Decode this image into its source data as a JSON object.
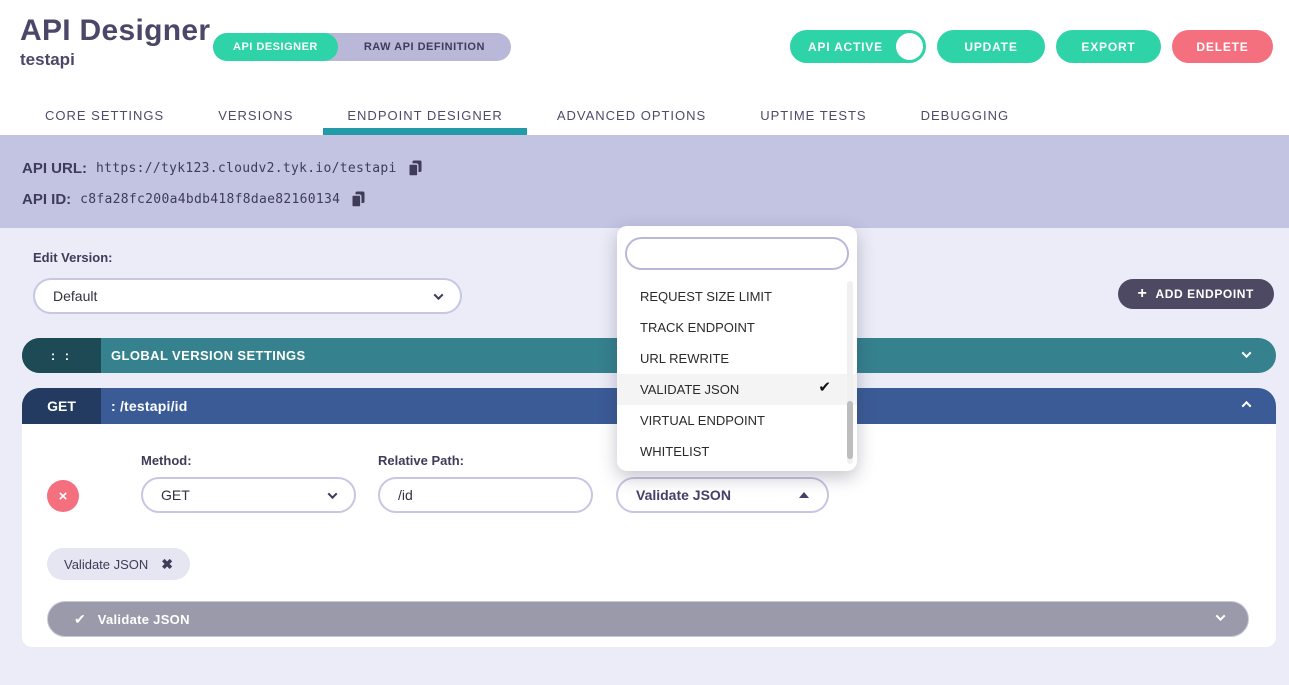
{
  "header": {
    "title": "API Designer",
    "subtitle": "testapi",
    "mode_toggle": {
      "api_designer": "API DESIGNER",
      "raw_api_definition": "RAW API DEFINITION"
    },
    "buttons": {
      "api_active": "API ACTIVE",
      "update": "UPDATE",
      "export": "EXPORT",
      "delete": "DELETE"
    }
  },
  "tabs": [
    {
      "label": "CORE SETTINGS",
      "active": false
    },
    {
      "label": "VERSIONS",
      "active": false
    },
    {
      "label": "ENDPOINT DESIGNER",
      "active": true
    },
    {
      "label": "ADVANCED OPTIONS",
      "active": false
    },
    {
      "label": "UPTIME TESTS",
      "active": false
    },
    {
      "label": "DEBUGGING",
      "active": false
    }
  ],
  "api_info": {
    "url_label": "API URL:",
    "url_value": "https://tyk123.cloudv2.tyk.io/testapi",
    "id_label": "API ID:",
    "id_value": "c8fa28fc200a4bdb418f8dae82160134"
  },
  "version_section": {
    "label": "Edit Version:",
    "selected_version": "Default",
    "add_endpoint_label": "ADD ENDPOINT"
  },
  "global_settings_bar": {
    "drag_handle": ": :",
    "title": "GLOBAL VERSION SETTINGS"
  },
  "endpoint_bar": {
    "method": "GET",
    "path": ": /testapi/id"
  },
  "endpoint_editor": {
    "method_label": "Method:",
    "method_value": "GET",
    "relative_path_label": "Relative Path:",
    "relative_path_value": "/id",
    "plugins_value": "Validate JSON",
    "selected_plugin_tag": "Validate JSON",
    "plugin_panel_title": "Validate JSON"
  },
  "plugin_dropdown": {
    "search_value": "",
    "options": [
      {
        "label": "REQUEST SIZE LIMIT",
        "selected": false
      },
      {
        "label": "TRACK ENDPOINT",
        "selected": false
      },
      {
        "label": "URL REWRITE",
        "selected": false
      },
      {
        "label": "VALIDATE JSON",
        "selected": true
      },
      {
        "label": "VIRTUAL ENDPOINT",
        "selected": false
      },
      {
        "label": "WHITELIST",
        "selected": false
      }
    ]
  },
  "icons": {
    "checkmark": "✔",
    "close_x": "✖",
    "remove_x": "×",
    "plus": "+"
  },
  "colors": {
    "teal_accent": "#2ed3a8",
    "delete_red": "#f4707e",
    "tab_underline_teal": "#229aa7",
    "banner_purple": "#c3c4e2",
    "page_background": "#ebecf7",
    "global_bar_teal": "#35818e",
    "global_bar_dark": "#1d4a54",
    "endpoint_bar_blue": "#3b5b97",
    "endpoint_bar_dark": "#243b61",
    "add_endpoint_slate": "#4d4963",
    "plugin_bar_gray": "#9b9aaa"
  }
}
